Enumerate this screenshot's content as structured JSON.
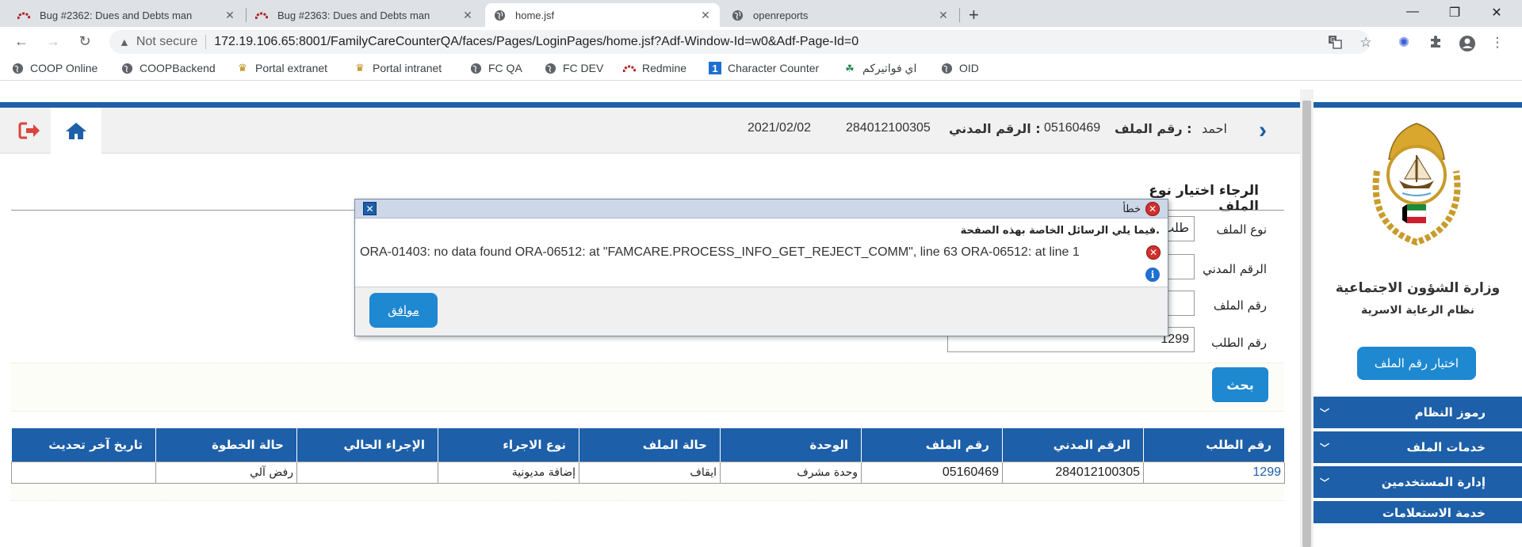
{
  "browser": {
    "tabs": [
      {
        "title": "Bug #2362: Dues and Debts man",
        "icon": "redmine-icon",
        "active": false
      },
      {
        "title": "Bug #2363: Dues and Debts man",
        "icon": "redmine-icon",
        "active": false
      },
      {
        "title": "home.jsf",
        "icon": "globe-icon",
        "active": true
      },
      {
        "title": "openreports",
        "icon": "globe-icon",
        "active": false
      }
    ],
    "new_tab": "+",
    "security_label": "Not secure",
    "url": "172.19.106.65:8001/FamilyCareCounterQA/faces/Pages/LoginPages/home.jsf?Adf-Window-Id=w0&Adf-Page-Id=0",
    "bookmarks": [
      {
        "label": "COOP Online",
        "icon": "globe-icon"
      },
      {
        "label": "COOPBackend",
        "icon": "globe-icon"
      },
      {
        "label": "Portal extranet",
        "icon": "emblem-icon"
      },
      {
        "label": "Portal intranet",
        "icon": "emblem-icon"
      },
      {
        "label": "FC QA",
        "icon": "globe-icon"
      },
      {
        "label": "FC DEV",
        "icon": "globe-icon"
      },
      {
        "label": "Redmine",
        "icon": "redmine-icon"
      },
      {
        "label": "Character Counter",
        "icon": "counter-icon"
      },
      {
        "label": "اي فواتيركم",
        "icon": "leaf-icon"
      },
      {
        "label": "OID",
        "icon": "globe-icon"
      }
    ]
  },
  "header": {
    "name": "احمد",
    "file_no_label": "رقم الملف :",
    "file_no": "05160469",
    "civil_id_label": "الرقم المدني :",
    "civil_id": "284012100305",
    "date": "2021/02/02"
  },
  "sidebar": {
    "ministry": "وزارة الشؤون الاجتماعية",
    "system": "نظام الرعاية الاسرية",
    "choose_button": "اختيار رقم الملف",
    "menu": [
      {
        "label": "رموز النظام"
      },
      {
        "label": "خدمات الملف"
      },
      {
        "label": "إدارة المستخدمين"
      },
      {
        "label": "خدمة الاستعلامات"
      }
    ]
  },
  "form": {
    "title": "الرجاء اختيار نوع الملف",
    "file_type_label": "نوع الملف",
    "file_type_value": "طلب",
    "civil_id_label": "الرقم المدني",
    "civil_id_value": "",
    "file_no_label": "رقم الملف",
    "file_no_value": "",
    "request_no_label": "رقم الطلب",
    "request_no_value": "1299",
    "search_button": "بحث"
  },
  "table": {
    "columns": [
      "رقم الطلب",
      "الرقم المدني",
      "رقم الملف",
      "الوحدة",
      "حالة الملف",
      "نوع الاجراء",
      "الإجراء الحالي",
      "حالة الخطوة",
      "تاريخ آخر تحديث"
    ],
    "rows": [
      [
        "1299",
        "284012100305",
        "05160469",
        "وحدة مشرف",
        "ايقاف",
        "إضافة مديونية",
        "",
        "رفض آلي",
        ""
      ]
    ]
  },
  "dialog": {
    "title": "خطأ",
    "subtitle": "فيما يلي الرسائل الخاصة بهذه الصفحة.",
    "message": "ORA-01403: no data found ORA-06512: at \"FAMCARE.PROCESS_INFO_GET_REJECT_COMM\", line 63 ORA-06512: at line 1",
    "ok_button": "موافق"
  },
  "colors": {
    "primary": "#1d5fa8",
    "button": "#1e88d0",
    "error": "#d0312d"
  }
}
